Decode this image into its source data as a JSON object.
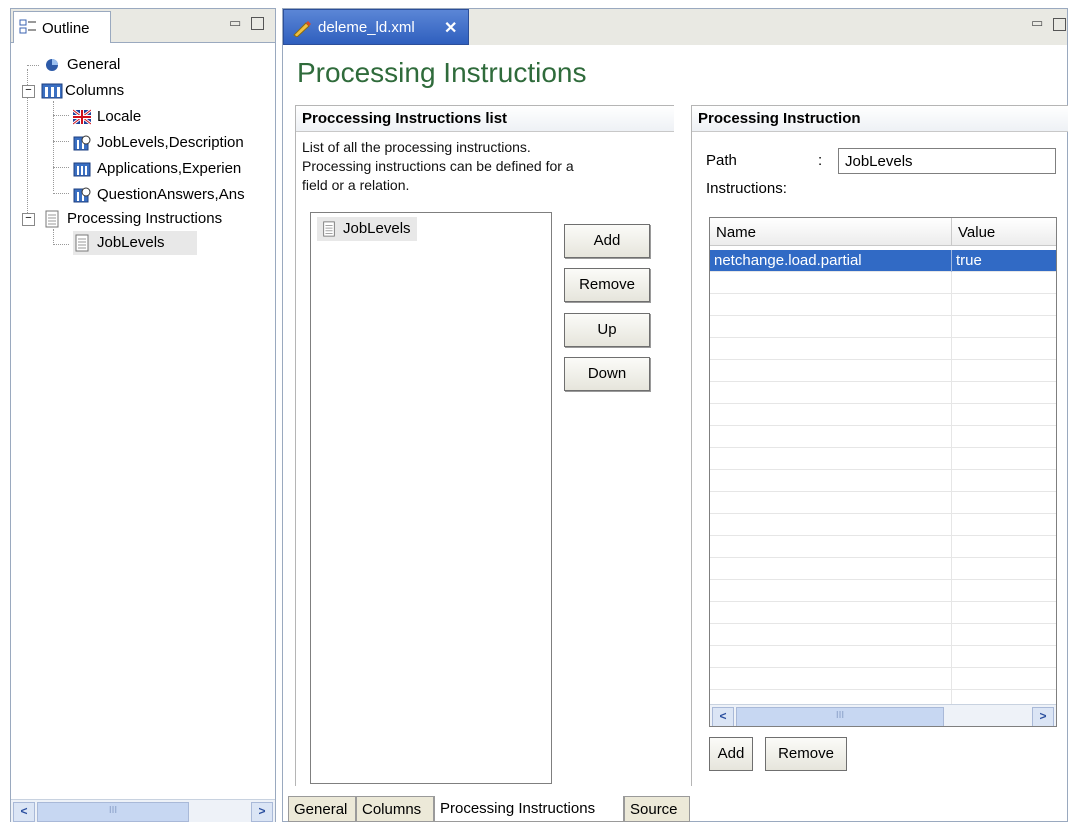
{
  "outline": {
    "tab_label": "Outline",
    "tree": [
      {
        "label": "General",
        "icon": "general-icon"
      },
      {
        "label": "Columns",
        "icon": "columns-icon"
      },
      {
        "label": "Locale",
        "icon": "locale-flag-icon"
      },
      {
        "label": "JobLevels,Description",
        "icon": "column-relation-icon"
      },
      {
        "label": "Applications,Experien",
        "icon": "columns-icon"
      },
      {
        "label": "QuestionAnswers,Ans",
        "icon": "column-relation-icon"
      },
      {
        "label": "Processing Instructions",
        "icon": "processing-instructions-icon"
      },
      {
        "label": "JobLevels",
        "icon": "processing-instruction-icon"
      }
    ],
    "scroll_thumb": "III"
  },
  "editor": {
    "file_tab_label": "deleme_ld.xml",
    "close_glyph": "✕",
    "page_title": "Processing Instructions",
    "list_section": {
      "title": "Proccessing Instructions list",
      "description_line1": "List of all the processing instructions.",
      "description_line2": "Processing instructions can be defined for a",
      "description_line3": "field or a relation.",
      "items": [
        "JobLevels"
      ],
      "buttons": {
        "add": "Add",
        "remove": "Remove",
        "up": "Up",
        "down": "Down"
      }
    },
    "detail_section": {
      "title": "Processing Instruction",
      "path_label": "Path",
      "path_colon": ":",
      "path_value": "JobLevels",
      "instructions_label": "Instructions:",
      "columns": [
        "Name",
        "Value"
      ],
      "rows": [
        {
          "name": "netchange.load.partial",
          "value": "true"
        }
      ],
      "buttons": {
        "add": "Add",
        "remove": "Remove"
      },
      "scroll_thumb": "III"
    },
    "bottom_tabs": [
      "General",
      "Columns",
      "Processing Instructions",
      "Source"
    ],
    "active_bottom_tab": "Processing Instructions"
  },
  "colors": {
    "title_green": "#2f6b3b",
    "selection_blue": "#316ac5",
    "active_tab_blue": "#2f5fbe"
  }
}
